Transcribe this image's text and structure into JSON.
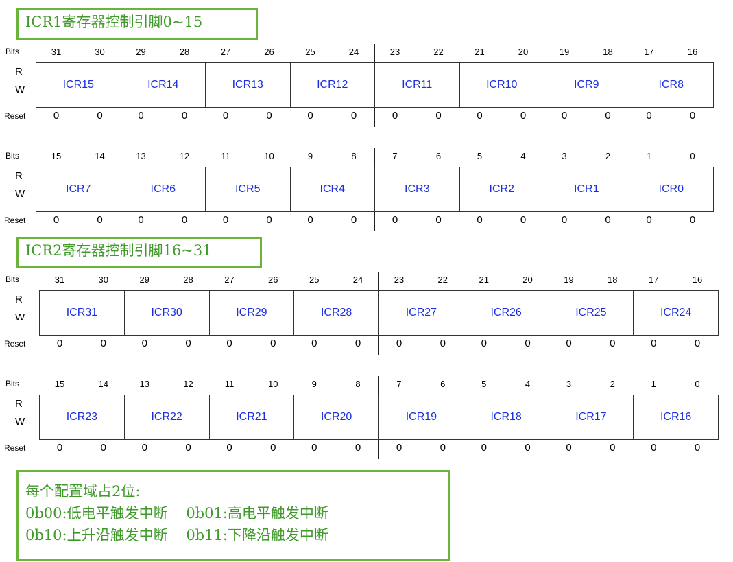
{
  "sections": [
    {
      "title": "ICR1寄存器控制引脚0~15",
      "registers": [
        {
          "bits": [
            "31",
            "30",
            "29",
            "28",
            "27",
            "26",
            "25",
            "24",
            "23",
            "22",
            "21",
            "20",
            "19",
            "18",
            "17",
            "16"
          ],
          "fields": [
            "ICR15",
            "ICR14",
            "ICR13",
            "ICR12",
            "ICR11",
            "ICR10",
            "ICR9",
            "ICR8"
          ],
          "reset": [
            "0",
            "0",
            "0",
            "0",
            "0",
            "0",
            "0",
            "0",
            "0",
            "0",
            "0",
            "0",
            "0",
            "0",
            "0",
            "0"
          ]
        },
        {
          "bits": [
            "15",
            "14",
            "13",
            "12",
            "11",
            "10",
            "9",
            "8",
            "7",
            "6",
            "5",
            "4",
            "3",
            "2",
            "1",
            "0"
          ],
          "fields": [
            "ICR7",
            "ICR6",
            "ICR5",
            "ICR4",
            "ICR3",
            "ICR2",
            "ICR1",
            "ICR0"
          ],
          "reset": [
            "0",
            "0",
            "0",
            "0",
            "0",
            "0",
            "0",
            "0",
            "0",
            "0",
            "0",
            "0",
            "0",
            "0",
            "0",
            "0"
          ]
        }
      ]
    },
    {
      "title": "ICR2寄存器控制引脚16~31",
      "registers": [
        {
          "bits": [
            "31",
            "30",
            "29",
            "28",
            "27",
            "26",
            "25",
            "24",
            "23",
            "22",
            "21",
            "20",
            "19",
            "18",
            "17",
            "16"
          ],
          "fields": [
            "ICR31",
            "ICR30",
            "ICR29",
            "ICR28",
            "ICR27",
            "ICR26",
            "ICR25",
            "ICR24"
          ],
          "reset": [
            "0",
            "0",
            "0",
            "0",
            "0",
            "0",
            "0",
            "0",
            "0",
            "0",
            "0",
            "0",
            "0",
            "0",
            "0",
            "0"
          ]
        },
        {
          "bits": [
            "15",
            "14",
            "13",
            "12",
            "11",
            "10",
            "9",
            "8",
            "7",
            "6",
            "5",
            "4",
            "3",
            "2",
            "1",
            "0"
          ],
          "fields": [
            "ICR23",
            "ICR22",
            "ICR21",
            "ICR20",
            "ICR19",
            "ICR18",
            "ICR17",
            "ICR16"
          ],
          "reset": [
            "0",
            "0",
            "0",
            "0",
            "0",
            "0",
            "0",
            "0",
            "0",
            "0",
            "0",
            "0",
            "0",
            "0",
            "0",
            "0"
          ]
        }
      ]
    }
  ],
  "labels": {
    "bits": "Bits",
    "r": "R",
    "w": "W",
    "reset": "Reset"
  },
  "note": {
    "heading": "每个配置域占2位:",
    "rows": [
      [
        "0b00:低电平触发中断",
        "0b01:高电平触发中断"
      ],
      [
        "0b10:上升沿触发中断",
        "0b11:下降沿触发中断"
      ]
    ]
  },
  "colors": {
    "accent_green": "#6bb33b",
    "title_text": "#3f9a2a",
    "field_text": "#1a2ee0"
  }
}
